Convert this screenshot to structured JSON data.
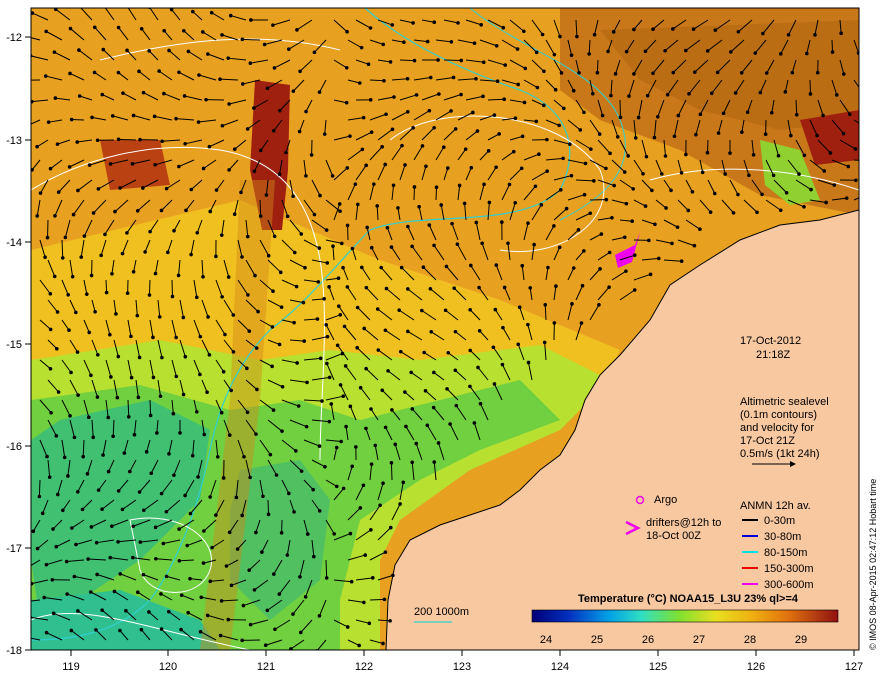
{
  "map": {
    "lon_ticks": [
      "119",
      "120",
      "121",
      "122",
      "123",
      "124",
      "125",
      "126",
      "127"
    ],
    "lat_ticks": [
      "-12",
      "-13",
      "-14",
      "-15",
      "-16",
      "-17",
      "-18"
    ],
    "date": "17-Oct-2012",
    "time": "21:18Z",
    "altimetry_lines": [
      "Altimetric sealevel",
      "(0.1m contours)",
      "and velocity for",
      "17-Oct 21Z",
      "0.5m/s (1kt 24h)"
    ],
    "argo_label": "Argo",
    "drifters_label": [
      "drifters@12h to",
      "18-Oct 00Z"
    ],
    "anmn_title": "ANMN 12h av.",
    "anmn_legend": [
      {
        "label": "0-30m",
        "color": "#000000"
      },
      {
        "label": "30-80m",
        "color": "#0000dd"
      },
      {
        "label": "80-150m",
        "color": "#00e0e0"
      },
      {
        "label": "150-300m",
        "color": "#ee0000"
      },
      {
        "label": "300-600m",
        "color": "#ee00ee"
      }
    ],
    "isobath_label": "200  1000m",
    "colorbar_title": "Temperature (°C) NOAA15_L3U 23% ql>=4",
    "colorbar_ticks": [
      "24",
      "25",
      "26",
      "27",
      "28",
      "29"
    ],
    "credit": "© IMOS 08-Apr-2015 02:47:12 Hobart time"
  }
}
